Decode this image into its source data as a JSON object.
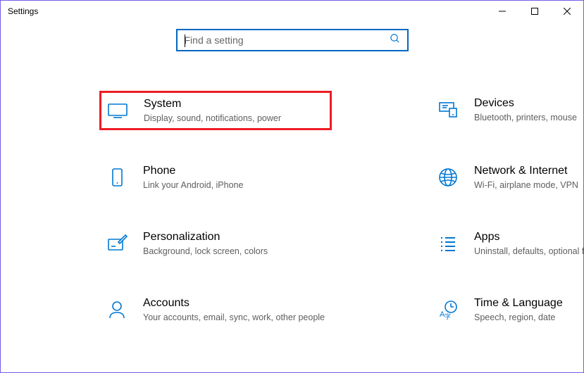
{
  "window": {
    "title": "Settings"
  },
  "search": {
    "placeholder": "Find a setting"
  },
  "categories": [
    {
      "title": "System",
      "desc": "Display, sound, notifications, power",
      "highlighted": true
    },
    {
      "title": "Devices",
      "desc": "Bluetooth, printers, mouse",
      "highlighted": false
    },
    {
      "title": "Phone",
      "desc": "Link your Android, iPhone",
      "highlighted": false
    },
    {
      "title": "Network & Internet",
      "desc": "Wi-Fi, airplane mode, VPN",
      "highlighted": false
    },
    {
      "title": "Personalization",
      "desc": "Background, lock screen, colors",
      "highlighted": false
    },
    {
      "title": "Apps",
      "desc": "Uninstall, defaults, optional features",
      "highlighted": false
    },
    {
      "title": "Accounts",
      "desc": "Your accounts, email, sync, work, other people",
      "highlighted": false
    },
    {
      "title": "Time & Language",
      "desc": "Speech, region, date",
      "highlighted": false
    }
  ]
}
